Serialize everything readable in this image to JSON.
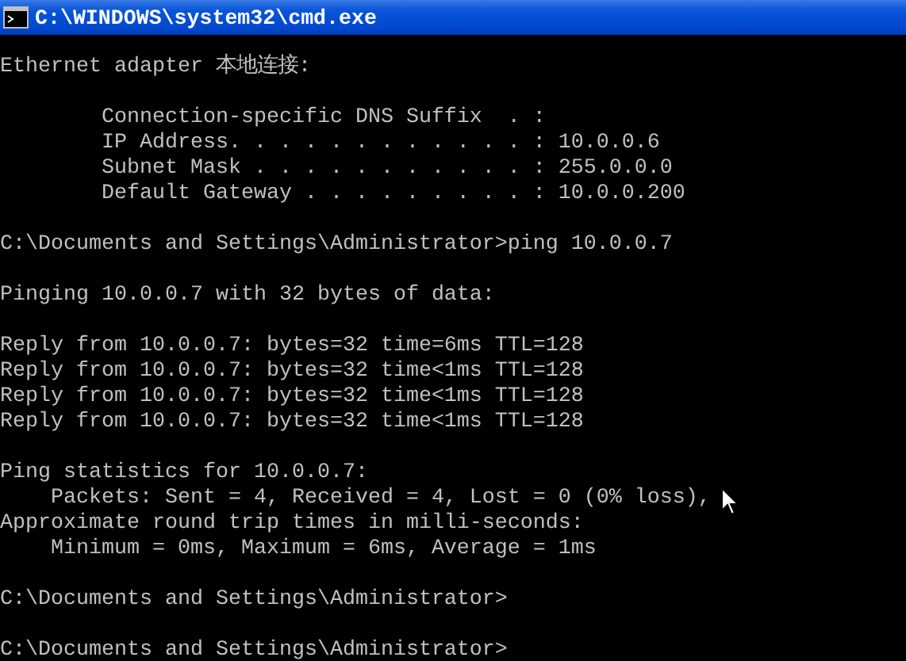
{
  "window": {
    "title": "C:\\WINDOWS\\system32\\cmd.exe"
  },
  "console": {
    "blocks": [
      [
        "Ethernet adapter 本地连接:"
      ],
      [
        "        Connection-specific DNS Suffix  . :",
        "        IP Address. . . . . . . . . . . . : 10.0.0.6",
        "        Subnet Mask . . . . . . . . . . . : 255.0.0.0",
        "        Default Gateway . . . . . . . . . : 10.0.0.200"
      ],
      [
        "C:\\Documents and Settings\\Administrator>ping 10.0.0.7"
      ],
      [
        "Pinging 10.0.0.7 with 32 bytes of data:"
      ],
      [
        "Reply from 10.0.0.7: bytes=32 time=6ms TTL=128",
        "Reply from 10.0.0.7: bytes=32 time<1ms TTL=128",
        "Reply from 10.0.0.7: bytes=32 time<1ms TTL=128",
        "Reply from 10.0.0.7: bytes=32 time<1ms TTL=128"
      ],
      [
        "Ping statistics for 10.0.0.7:",
        "    Packets: Sent = 4, Received = 4, Lost = 0 (0% loss),",
        "Approximate round trip times in milli-seconds:",
        "    Minimum = 0ms, Maximum = 6ms, Average = 1ms"
      ],
      [
        "C:\\Documents and Settings\\Administrator>"
      ],
      [
        "C:\\Documents and Settings\\Administrator>"
      ]
    ]
  }
}
